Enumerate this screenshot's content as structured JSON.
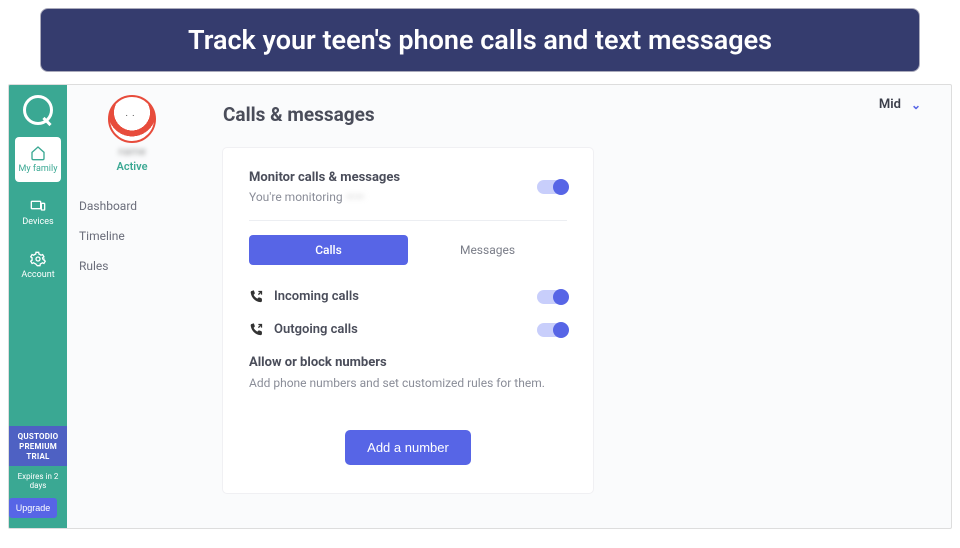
{
  "banner": "Track your teen's phone calls and text messages",
  "sidebar": {
    "items": [
      {
        "label": "My family"
      },
      {
        "label": "Devices"
      },
      {
        "label": "Account"
      }
    ],
    "trial": {
      "title": "QUSTODIO PREMIUM TRIAL",
      "expires": "Expires in 2 days",
      "upgrade": "Upgrade"
    }
  },
  "profile": {
    "name_redacted": "name",
    "status": "Active",
    "nav": [
      "Dashboard",
      "Timeline",
      "Rules"
    ]
  },
  "header": {
    "selector": "Mid"
  },
  "page": {
    "title": "Calls & messages",
    "monitor": {
      "title": "Monitor calls & messages",
      "subtext_prefix": "You're monitoring ",
      "subtext_redacted": "——"
    },
    "tabs": {
      "calls": "Calls",
      "messages": "Messages"
    },
    "items": {
      "incoming": "Incoming calls",
      "outgoing": "Outgoing calls"
    },
    "block": {
      "title": "Allow or block numbers",
      "sub": "Add phone numbers and set customized rules for them.",
      "button": "Add a number"
    }
  }
}
